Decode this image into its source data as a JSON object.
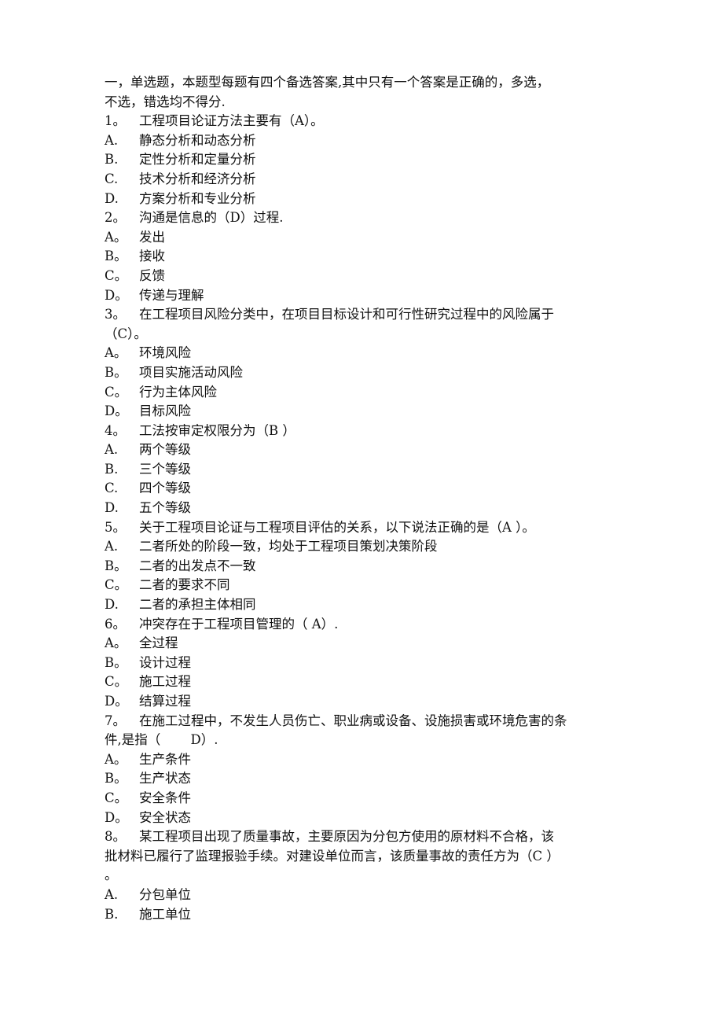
{
  "intro": {
    "line1": "一，单选题，本题型每题有四个备选答案,其中只有一个答案是正确的，多选，",
    "line2": "不选，错选均不得分."
  },
  "questions": [
    {
      "number": "1。",
      "stem": [
        "工程项目论证方法主要有（A）。"
      ],
      "options": [
        {
          "label": "A.",
          "text": "静态分析和动态分析"
        },
        {
          "label": "B.",
          "text": "定性分析和定量分析"
        },
        {
          "label": "C.",
          "text": "技术分析和经济分析"
        },
        {
          "label": "D.",
          "text": "方案分析和专业分析"
        }
      ]
    },
    {
      "number": "2。",
      "stem": [
        "沟通是信息的（D）过程."
      ],
      "options": [
        {
          "label": "A。",
          "text": "发出"
        },
        {
          "label": "B。",
          "text": "接收"
        },
        {
          "label": "C。",
          "text": "反馈"
        },
        {
          "label": "D。",
          "text": "传递与理解"
        }
      ]
    },
    {
      "number": "3。",
      "stem": [
        "在工程项目风险分类中，在项目目标设计和可行性研究过程中的风险属于",
        "（C）。"
      ],
      "options": [
        {
          "label": "A。",
          "text": "环境风险"
        },
        {
          "label": "B。",
          "text": "项目实施活动风险"
        },
        {
          "label": "C。",
          "text": "行为主体风险"
        },
        {
          "label": "D。",
          "text": "目标风险"
        }
      ]
    },
    {
      "number": "4。",
      "stem": [
        "工法按审定权限分为（B ）"
      ],
      "options": [
        {
          "label": "A.",
          "text": "两个等级"
        },
        {
          "label": "B.",
          "text": "三个等级"
        },
        {
          "label": "C.",
          "text": "四个等级"
        },
        {
          "label": "D.",
          "text": "五个等级"
        }
      ]
    },
    {
      "number": "5。",
      "stem": [
        "关于工程项目论证与工程项目评估的关系，以下说法正确的是（A ）。"
      ],
      "options": [
        {
          "label": "A.",
          "text": "二者所处的阶段一致，均处于工程项目策划决策阶段"
        },
        {
          "label": "B。",
          "text": "二者的出发点不一致"
        },
        {
          "label": "C。",
          "text": "二者的要求不同"
        },
        {
          "label": "D.",
          "text": "二者的承担主体相同"
        }
      ]
    },
    {
      "number": "6。",
      "stem": [
        "冲突存在于工程项目管理的（ A）."
      ],
      "options": [
        {
          "label": "A。",
          "text": "全过程"
        },
        {
          "label": "B。",
          "text": "设计过程"
        },
        {
          "label": "C。",
          "text": "施工过程"
        },
        {
          "label": "D。",
          "text": "结算过程"
        }
      ]
    },
    {
      "number": "7。",
      "stem": [
        "在施工过程中，不发生人员伤亡、职业病或设备、设施损害或环境危害的条",
        "件,是指（　　 D）."
      ],
      "options": [
        {
          "label": "A。",
          "text": "生产条件"
        },
        {
          "label": "B。",
          "text": "生产状态"
        },
        {
          "label": "C。",
          "text": "安全条件"
        },
        {
          "label": "D。",
          "text": "安全状态"
        }
      ]
    },
    {
      "number": "8。",
      "stem": [
        "某工程项目出现了质量事故，主要原因为分包方使用的原材料不合格，该",
        "批材料已履行了监理报验手续。对建设单位而言，该质量事故的责任方为（C ）",
        "。"
      ],
      "options": [
        {
          "label": "A.",
          "text": "分包单位"
        },
        {
          "label": "B.",
          "text": "施工单位"
        }
      ]
    }
  ]
}
